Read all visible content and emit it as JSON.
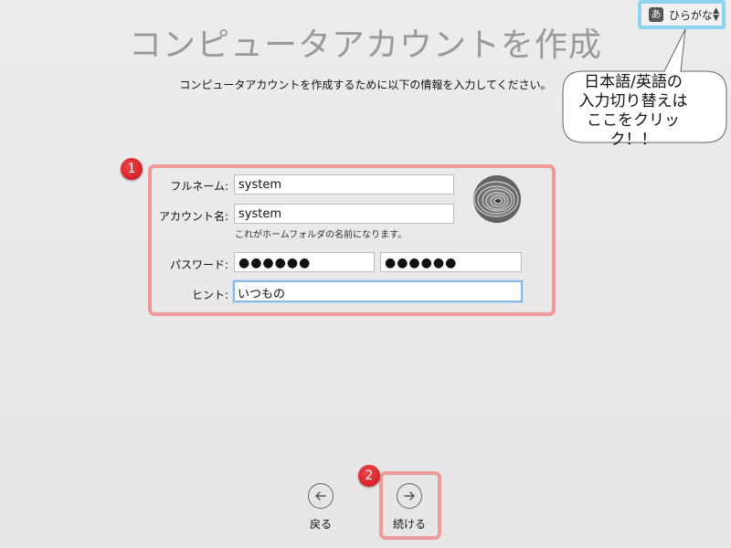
{
  "header": {
    "title": "コンピュータアカウントを作成",
    "subtitle": "コンピュータアカウントを作成するために以下の情報を入力してください。"
  },
  "input_source": {
    "badge": "あ",
    "label": "ひらがな",
    "arrows_up": "▲",
    "arrows_down": "▼"
  },
  "callout": {
    "lines": [
      "日本語/英語の",
      "入力切り替えは",
      "ここをクリック！！"
    ]
  },
  "badges": {
    "one": "1",
    "two": "2"
  },
  "form": {
    "fullname_label": "フルネーム:",
    "fullname_value": "system",
    "account_label": "アカウント名:",
    "account_value": "system",
    "account_note": "これがホームフォルダの名前になります。",
    "password_label": "パスワード:",
    "password_value": "●●●●●●",
    "verify_value": "●●●●●●",
    "hint_label": "ヒント:",
    "hint_value": "いつもの"
  },
  "nav": {
    "back_label": "戻る",
    "continue_label": "続ける"
  },
  "colors": {
    "annotation_frame": "#ee9a9a",
    "badge_red": "#d91c24",
    "input_switch_highlight": "#8fd3ee",
    "title_gray": "#9a9a9a"
  }
}
